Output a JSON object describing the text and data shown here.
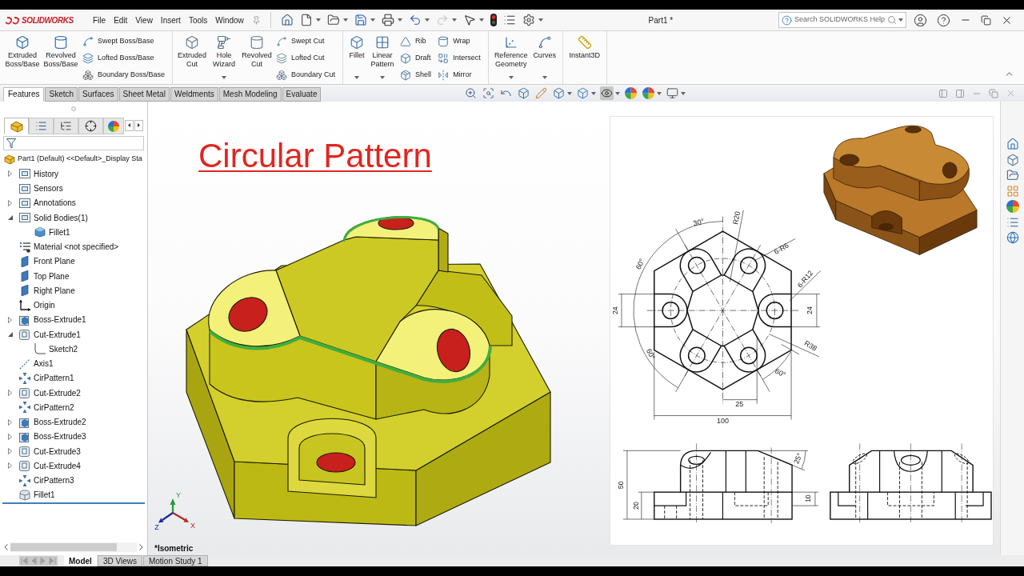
{
  "title_bar": {
    "logo": "SOLIDWORKS",
    "menu": [
      "File",
      "Edit",
      "View",
      "Insert",
      "Tools",
      "Window"
    ],
    "quick_access": [
      {
        "menu": false,
        "disabled": false
      },
      {
        "menu": true,
        "disabled": false
      },
      {
        "menu": true,
        "disabled": false
      },
      {
        "menu": true,
        "disabled": false
      },
      {
        "menu": true,
        "disabled": false
      },
      {
        "menu": true,
        "disabled": false
      },
      {
        "menu": true,
        "disabled": true
      },
      {
        "menu": true,
        "disabled": false
      },
      {
        "menu": false,
        "disabled": false
      },
      {
        "menu": false,
        "disabled": false
      },
      {
        "menu": true,
        "disabled": false
      }
    ],
    "document": "Part1 *",
    "search": {
      "placeholder": "Search SOLIDWORKS Help"
    }
  },
  "ribbon": {
    "groups": [
      [
        {
          "kind": "large",
          "label": "Extruded\nBoss/Base",
          "menu": false
        },
        {
          "kind": "large",
          "label": "Revolved\nBoss/Base",
          "menu": false
        },
        {
          "kind": "stack",
          "items": [
            "Swept Boss/Base",
            "Lofted Boss/Base",
            "Boundary Boss/Base"
          ]
        }
      ],
      [
        {
          "kind": "large",
          "label": "Extruded\nCut",
          "menu": false
        },
        {
          "kind": "large",
          "label": "Hole\nWizard",
          "menu": true
        },
        {
          "kind": "large",
          "label": "Revolved\nCut",
          "menu": false
        },
        {
          "kind": "stack",
          "items": [
            "Swept Cut",
            "Lofted Cut",
            "Boundary Cut"
          ]
        }
      ],
      [
        {
          "kind": "large",
          "label": "Fillet",
          "menu": true
        },
        {
          "kind": "large",
          "label": "Linear\nPattern",
          "menu": true
        },
        {
          "kind": "stack",
          "items": [
            "Rib",
            "Draft",
            "Shell"
          ]
        },
        {
          "kind": "stack",
          "items": [
            "Wrap",
            "Intersect",
            "Mirror"
          ]
        }
      ],
      [
        {
          "kind": "large",
          "label": "Reference\nGeometry",
          "menu": true
        },
        {
          "kind": "large",
          "label": "Curves",
          "menu": true
        }
      ],
      [
        {
          "kind": "large",
          "label": "Instant3D",
          "menu": false
        }
      ]
    ]
  },
  "tabs": [
    {
      "label": "Features",
      "selected": true
    },
    {
      "label": "Sketch",
      "selected": false
    },
    {
      "label": "Surfaces",
      "selected": false
    },
    {
      "label": "Sheet Metal",
      "selected": false
    },
    {
      "label": "Weldments",
      "selected": false
    },
    {
      "label": "Mesh Modeling",
      "selected": false
    },
    {
      "label": "Evaluate",
      "selected": false
    }
  ],
  "view_toolbar": [
    {
      "selected": false,
      "menu": false
    },
    {
      "selected": false,
      "menu": false
    },
    {
      "selected": false,
      "menu": false
    },
    {
      "selected": false,
      "menu": false
    },
    {
      "selected": false,
      "menu": false
    },
    {
      "selected": false,
      "menu": true
    },
    {
      "selected": false,
      "menu": true
    },
    {
      "selected": true,
      "menu": true
    },
    {
      "selected": false,
      "menu": false
    },
    {
      "selected": false,
      "menu": true
    },
    {
      "selected": false,
      "menu": true
    }
  ],
  "feature_manager": {
    "tabs": [
      {
        "selected": true
      },
      {
        "selected": false
      },
      {
        "selected": false
      },
      {
        "selected": false
      },
      {
        "selected": false
      }
    ],
    "tree": {
      "label": "Part1 (Default) <<Default>_Display Sta",
      "kind": "part",
      "children": [
        {
          "label": "History",
          "kind": "folder",
          "expanded": false
        },
        {
          "label": "Sensors",
          "kind": "folder"
        },
        {
          "label": "Annotations",
          "kind": "folder",
          "expanded": false
        },
        {
          "label": "Solid Bodies(1)",
          "kind": "folder",
          "expanded": true,
          "children": [
            {
              "label": "Fillet1",
              "kind": "body"
            }
          ]
        },
        {
          "label": "Material <not specified>",
          "kind": "material"
        },
        {
          "label": "Front Plane",
          "kind": "plane"
        },
        {
          "label": "Top Plane",
          "kind": "plane"
        },
        {
          "label": "Right Plane",
          "kind": "plane"
        },
        {
          "label": "Origin",
          "kind": "origin"
        },
        {
          "label": "Boss-Extrude1",
          "kind": "boss",
          "expanded": false
        },
        {
          "label": "Cut-Extrude1",
          "kind": "cut",
          "expanded": true,
          "children": [
            {
              "label": "Sketch2",
              "kind": "sketch"
            }
          ]
        },
        {
          "label": "Axis1",
          "kind": "axis"
        },
        {
          "label": "CirPattern1",
          "kind": "pattern"
        },
        {
          "label": "Cut-Extrude2",
          "kind": "cut",
          "expanded": false
        },
        {
          "label": "CirPattern2",
          "kind": "pattern"
        },
        {
          "label": "Boss-Extrude2",
          "kind": "boss",
          "expanded": false
        },
        {
          "label": "Boss-Extrude3",
          "kind": "boss",
          "expanded": false
        },
        {
          "label": "Cut-Extrude3",
          "kind": "cut",
          "expanded": false
        },
        {
          "label": "Cut-Extrude4",
          "kind": "cut",
          "expanded": false
        },
        {
          "label": "CirPattern3",
          "kind": "pattern"
        },
        {
          "label": "Fillet1",
          "kind": "fillet"
        }
      ]
    }
  },
  "viewport": {
    "title": "Circular Pattern",
    "view_name": "*Isometric",
    "triad": [
      "Y",
      "X",
      "Z"
    ]
  },
  "drawing": {
    "top_view": [
      "30°",
      "R20",
      "6-R6",
      "6-R12",
      "60°",
      "24",
      "24",
      "R38",
      "60°",
      "60°",
      "25",
      "100"
    ],
    "front_view": [
      "50",
      "20",
      "25°",
      "10"
    ]
  },
  "bottom_tabs": [
    {
      "label": "Model",
      "selected": true
    },
    {
      "label": "3D Views",
      "selected": false
    },
    {
      "label": "Motion Study 1",
      "selected": false
    }
  ]
}
